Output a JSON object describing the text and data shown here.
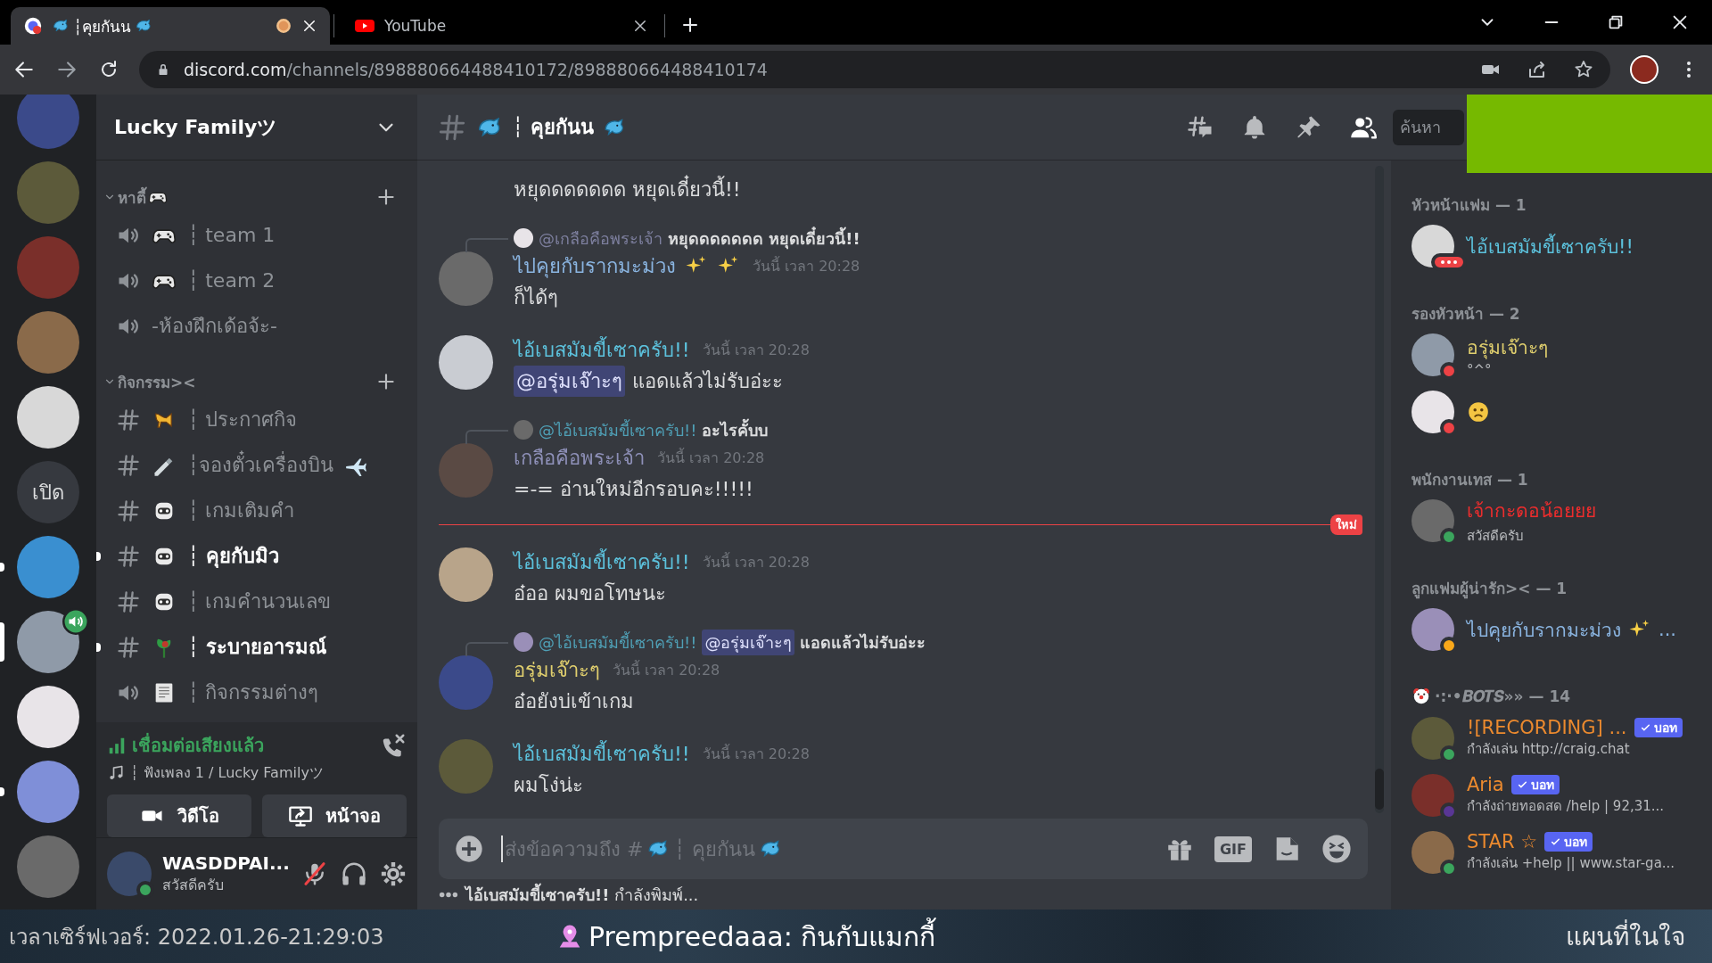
{
  "browser": {
    "tabs": [
      {
        "kind": "discord",
        "title": "┆คุยกันน",
        "selected": true,
        "recording": true
      },
      {
        "kind": "youtube",
        "title": "YouTube",
        "selected": false,
        "recording": false
      }
    ],
    "url": {
      "host": "discord.com",
      "path": "/channels/898880664488410172/898880664488410174"
    }
  },
  "servers": [
    {
      "kind": "avatar",
      "selected": false,
      "unread": false,
      "voice": false
    },
    {
      "kind": "avatar",
      "selected": false,
      "unread": false,
      "voice": false
    },
    {
      "kind": "avatar",
      "selected": false,
      "unread": false,
      "voice": false
    },
    {
      "kind": "avatar",
      "selected": false,
      "unread": false,
      "voice": false
    },
    {
      "kind": "avatar",
      "selected": false,
      "unread": false,
      "voice": false
    },
    {
      "kind": "text",
      "label": "เปิด",
      "selected": false,
      "unread": false,
      "voice": false
    },
    {
      "kind": "avatar",
      "selected": false,
      "unread": true,
      "voice": false
    },
    {
      "kind": "avatar",
      "selected": true,
      "unread": false,
      "voice": true
    },
    {
      "kind": "avatar",
      "selected": false,
      "unread": false,
      "voice": false
    },
    {
      "kind": "avatar",
      "selected": false,
      "unread": true,
      "voice": false
    },
    {
      "kind": "avatar",
      "selected": false,
      "unread": false,
      "voice": false
    }
  ],
  "guild": {
    "name": "Lucky Familyツ"
  },
  "categories": [
    {
      "name": "หาตี้",
      "expanded": true,
      "channels": [
        {
          "kind": "voice",
          "name": "┆ team 1",
          "unread": false
        },
        {
          "kind": "voice",
          "name": "┆ team 2",
          "unread": false
        },
        {
          "kind": "voice",
          "name": "-ห้องฝึกเด้อจ้ะ-",
          "unread": false
        }
      ]
    },
    {
      "name": "กิจกรรม><",
      "expanded": true,
      "channels": [
        {
          "kind": "text",
          "name": "┆ ประกาศกิจ",
          "unread": false
        },
        {
          "kind": "text",
          "name": "┆จองตั๋วเครื่องบิน",
          "unread": false
        },
        {
          "kind": "text",
          "name": "┆ เกมเติมคำ",
          "unread": false
        },
        {
          "kind": "text",
          "name": "┆ คุยกับมิว",
          "unread": true
        },
        {
          "kind": "text",
          "name": "┆ เกมคำนวนเลข",
          "unread": false
        },
        {
          "kind": "text",
          "name": "┆ ระบายอารมณ์",
          "unread": true
        },
        {
          "kind": "voice",
          "name": "┆ กิจกรรมต่างๆ",
          "unread": false
        }
      ]
    }
  ],
  "voice": {
    "status": "เชื่อมต่อเสียงแล้ว",
    "channel": "┆ ฟังเพลง 1 / Lucky Familyツ",
    "buttons": [
      {
        "kind": "video",
        "label": "วิดีโอ"
      },
      {
        "kind": "screen",
        "label": "หน้าจอ"
      }
    ]
  },
  "user": {
    "name": "WASDDPAI...",
    "status_text": "สวัสดีครับ",
    "presence": {
      "color": "#3ba55d"
    },
    "muted": true
  },
  "header": {
    "channel": "┆ คุยกันน",
    "search_placeholder": "ค้นหา",
    "members_open": true
  },
  "messages": [
    {
      "kind": "continuation",
      "text": "หยุดดดดดดด หยุดเดี๋ยวนี้!!"
    },
    {
      "kind": "message",
      "reply": {
        "author": "@เกลือคือพระเจ้า",
        "color": "#7d7f9e",
        "text": "หยุดดดดดดด หยุดเดี๋ยวนี้!!"
      },
      "author": "ไปคุยกับรากมะม่วง",
      "color": "#8ab4e0",
      "time": "วันนี้ เวลา 20:28",
      "text": "ก็ได้ๆ"
    },
    {
      "kind": "message",
      "author": "ไอ้เบสมัมขี้เซาครับ!!",
      "color": "#5cc2dd",
      "time": "วันนี้ เวลา 20:28",
      "mention": "@อรุ่มเจ๊าะๆ",
      "text": "แอดแล้วไม่รับอ่ะะ"
    },
    {
      "kind": "message",
      "reply": {
        "author": "@ไอ้เบสมัมขี้เซาครับ!!",
        "color": "#4f9fb5",
        "text": "อะไรคั้บบ"
      },
      "author": "เกลือคือพระเจ้า",
      "color": "#8e90b8",
      "time": "วันนี้ เวลา 20:28",
      "text": "=-= อ่านใหม่อีกรอบคะ!!!!!"
    },
    {
      "kind": "divider",
      "label": "ใหม่"
    },
    {
      "kind": "message",
      "author": "ไอ้เบสมัมขี้เซาครับ!!",
      "color": "#5cc2dd",
      "time": "วันนี้ เวลา 20:28",
      "text": "อ๋ออ ผมขอโทษนะ"
    },
    {
      "kind": "message",
      "reply": {
        "author": "@ไอ้เบสมัมขี้เซาครับ!!",
        "color": "#4f9fb5",
        "mention": "@อรุ่มเจ๊าะๆ",
        "text": "แอดแล้วไม่รับอ่ะะ"
      },
      "author": "อรุ่มเจ๊าะๆ",
      "color": "#e0cf6e",
      "time": "วันนี้ เวลา 20:28",
      "text": "อ๋อยังบ่เข้าเกม"
    },
    {
      "kind": "message",
      "author": "ไอ้เบสมัมขี้เซาครับ!!",
      "color": "#5cc2dd",
      "time": "วันนี้ เวลา 20:28",
      "text": "ผมโง่น่ะ"
    }
  ],
  "composer": {
    "placeholder": "ส่งข้อความถึง #",
    "placeholder_channel": "┆ คุยกันน",
    "gif_label": "GIF"
  },
  "typing": "**ไอ้เบสมัมขี้เซาครับ!!** กำลังพิมพ์...",
  "member_groups": [
    {
      "title": "หัวหน้าแฟม — 1",
      "members": [
        {
          "name": "ไอ้เบสมัมขี้เซาครับ!!",
          "color": "#5cc2dd",
          "presence": {
            "color": "#ed4245",
            "typing": true
          }
        }
      ]
    },
    {
      "title": "รองหัวหน้า — 2",
      "members": [
        {
          "name": "อรุ่มเจ๊าะๆ",
          "color": "#e0cf6e",
          "presence": {
            "color": "#ed4245",
            "typing": false
          },
          "activity": "°^°"
        },
        {
          "presence": {
            "color": "#ed4245",
            "typing": false
          }
        }
      ]
    },
    {
      "title": "พนักงานเทส — 1",
      "members": [
        {
          "name": "เจ้ากะดอน้อยยย",
          "color": "#ed2d2d",
          "presence": {
            "color": "#3ba55d",
            "typing": false
          },
          "activity": "สวัสดีครับ"
        }
      ]
    },
    {
      "title": "ลูกแฟมผู้น่ารัก>< — 1",
      "members": [
        {
          "name": "ไปคุยกับรากมะม่วง",
          "color": "#8ab4e0",
          "suffix": "...",
          "presence": {
            "color": "#faa81a",
            "typing": false
          }
        }
      ]
    },
    {
      "title": "·:·•𝑩𝑶𝑻𝑺»» — 14",
      "members": [
        {
          "name": "![RECORDING] ...",
          "color": "#ec8a2e",
          "bot_label": "บอท",
          "presence": {
            "color": "#3ba55d",
            "typing": false
          },
          "activity": "กำลังเล่น http://craig.chat"
        },
        {
          "name": "Aria",
          "color": "#ec8a2e",
          "bot_label": "บอท",
          "presence": {
            "color": "#593695",
            "typing": false
          },
          "activity": "กำลังถ่ายทอดสด /help | 92,31..."
        },
        {
          "name": "STAR ☆",
          "color": "#ec8a2e",
          "bot_label": "บอท",
          "presence": {
            "color": "#3ba55d",
            "typing": false
          },
          "activity": "กำลังเล่น +help || www.star-ga..."
        }
      ]
    }
  ],
  "stream_overlay": {
    "server_time": "เวลาเซิร์ฟเวอร์: 2022.01.26-21:29:03",
    "location": "Prempreedaaa: กินกับแมกกี้",
    "map_label": "แผนที่ในใจ"
  }
}
